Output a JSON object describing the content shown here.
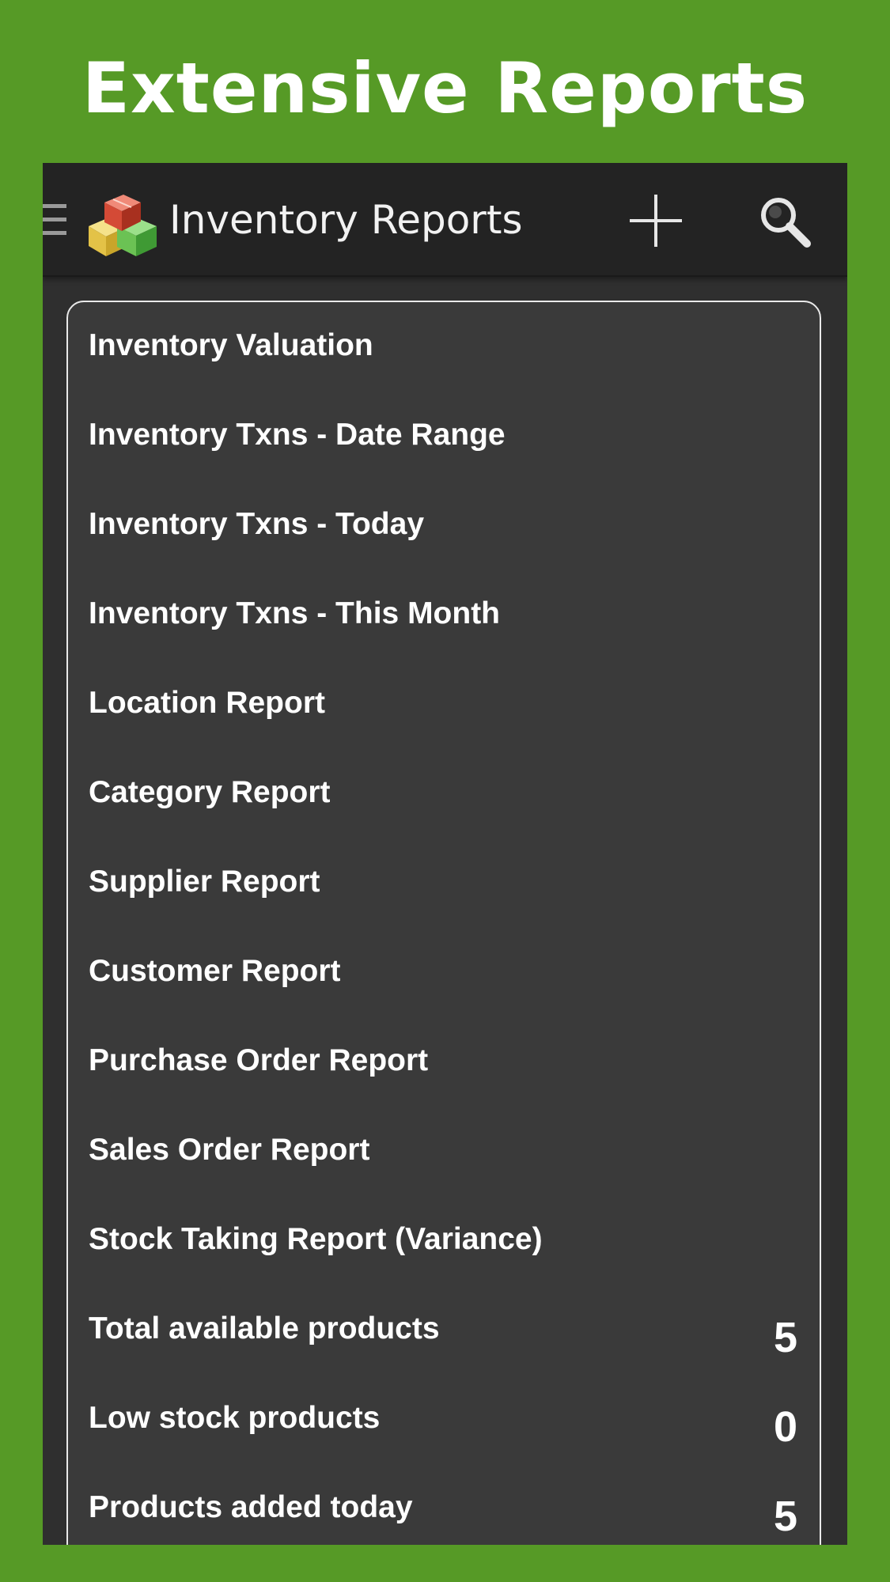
{
  "banner": {
    "title": "Extensive Reports"
  },
  "action_bar": {
    "title": "Inventory Reports",
    "icons": [
      "drawer-icon",
      "inventory-boxes-icon",
      "add-icon",
      "search-icon"
    ]
  },
  "reports": [
    {
      "label": "Inventory Valuation",
      "count": ""
    },
    {
      "label": "Inventory Txns - Date Range",
      "count": ""
    },
    {
      "label": "Inventory Txns - Today",
      "count": ""
    },
    {
      "label": "Inventory Txns - This Month",
      "count": ""
    },
    {
      "label": "Location Report",
      "count": ""
    },
    {
      "label": "Category Report",
      "count": ""
    },
    {
      "label": "Supplier Report",
      "count": ""
    },
    {
      "label": "Customer Report",
      "count": ""
    },
    {
      "label": "Purchase Order Report",
      "count": ""
    },
    {
      "label": "Sales Order Report",
      "count": ""
    },
    {
      "label": "Stock Taking Report (Variance)",
      "count": ""
    },
    {
      "label": "Total available products",
      "count": "5"
    },
    {
      "label": "Low stock products",
      "count": "0"
    },
    {
      "label": "Products added today",
      "count": "5"
    }
  ],
  "colors": {
    "background": "#569a26",
    "action_bar": "#232323",
    "panel": "#3a3a3a",
    "text": "#ffffff"
  }
}
